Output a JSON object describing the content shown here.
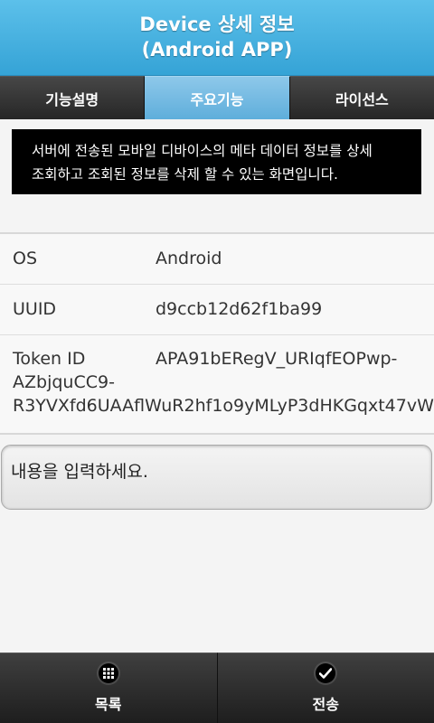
{
  "header": {
    "title_line1": "Device 상세 정보",
    "title_line2": "(Android APP)"
  },
  "tabs": [
    "기능설명",
    "주요기능",
    "라이선스"
  ],
  "active_tab": "주요기능",
  "notice": {
    "line1": "서버에 전송된 모바일 디바이스의 메타 데이터 정보를 상세",
    "line2": "조회하고 조회된 정보를 삭제 할 수 있는 화면입니다."
  },
  "info": {
    "os_label": "OS",
    "os_value": "Android",
    "uuid_label": "UUID",
    "uuid_value": "d9ccb12d62f1ba99",
    "token_label": "Token ID",
    "token_line1": "APA91bERegV_URIqfEOPwp-",
    "token_line2": "AZbjquCC9-",
    "token_line3": "R3YVXfd6UAAflWuR2hf1o9yMLyP3dHKGqxt47vW"
  },
  "message": {
    "placeholder": "내용을 입력하세요."
  },
  "footer": {
    "list_label": "목록",
    "list_icon": "grid-icon",
    "send_label": "전송",
    "send_icon": "checkmark-icon"
  },
  "colors": {
    "header": "#35a3d6",
    "active_tab": "#5eaedb",
    "tab_bar": "#2b2b2b",
    "notice_bg": "#000000"
  }
}
